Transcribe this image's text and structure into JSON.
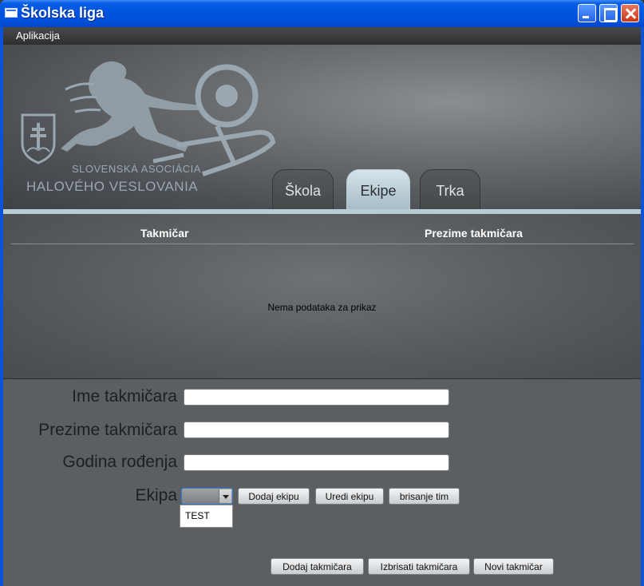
{
  "window": {
    "title": "Školska liga"
  },
  "menubar": {
    "items": [
      {
        "label": "Aplikacija"
      }
    ]
  },
  "logo": {
    "line1": "SLOVENSKÁ ASOCIÁCIA",
    "line2": "HALOVÉHO VESLOVANIA"
  },
  "tabs": [
    {
      "label": "Škola",
      "active": false
    },
    {
      "label": "Ekipe",
      "active": true
    },
    {
      "label": "Trka",
      "active": false
    }
  ],
  "table": {
    "columns": [
      "Takmičar",
      "Prezime takmičara"
    ],
    "empty_message": "Nema podataka za prikaz"
  },
  "form": {
    "fields": [
      {
        "label": "Ime takmičara",
        "value": ""
      },
      {
        "label": "Prezime takmičara",
        "value": ""
      },
      {
        "label": "Godina rođenja",
        "value": ""
      }
    ],
    "team_label": "Ekipa",
    "team_selected": "",
    "team_options": [
      "TEST"
    ],
    "team_buttons": [
      "Dodaj ekipu",
      "Uredi ekipu",
      "brisanje tim"
    ],
    "action_buttons": [
      "Dodaj takmičara",
      "Izbrisati takmičara",
      "Novi takmičar"
    ]
  },
  "colors": {
    "titlebar": "#0053e0",
    "active_tab": "#b9cbd3",
    "form_background": "#5b5f62"
  }
}
